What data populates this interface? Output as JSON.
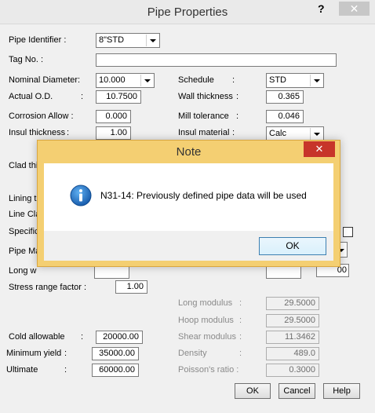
{
  "window": {
    "title": "Pipe Properties",
    "help_glyph": "?",
    "close_glyph": "✕"
  },
  "form": {
    "pipe_identifier": {
      "label": "Pipe Identifier :",
      "value": "8\"STD"
    },
    "tag_no": {
      "label": "Tag No. :",
      "value": ""
    },
    "nominal_diameter": {
      "label": "Nominal Diameter:",
      "value": "10.000"
    },
    "schedule": {
      "label": "Schedule",
      "colon": ":",
      "value": "STD"
    },
    "actual_od": {
      "label": "Actual O.D.",
      "colon": ":",
      "value": "10.7500"
    },
    "wall_thickness": {
      "label": "Wall thickness",
      "colon": ":",
      "value": "0.365"
    },
    "corrosion_allow": {
      "label": "Corrosion Allow :",
      "value": "0.000"
    },
    "mill_tolerance": {
      "label": "Mill tolerance",
      "colon": ":",
      "value": "0.046"
    },
    "insul_thickness": {
      "label": "Insul thickness",
      "colon": ":",
      "value": "1.00"
    },
    "insul_material": {
      "label": "Insul material",
      "colon": ":",
      "value": "Calc"
    },
    "clad_thickness_partial": "Clad thi",
    "lining_partial": "Lining th",
    "line_class_partial": "Line Cla",
    "specification_partial": "Specific",
    "pipe_material_partial": "Pipe Ma",
    "long_weld_partial": "Long w",
    "stress_range_factor": {
      "label": "Stress range factor :",
      "value": "1.00"
    },
    "long_modulus": {
      "label": "Long modulus",
      "colon": ":",
      "value": "29.5000"
    },
    "hoop_modulus": {
      "label": "Hoop modulus",
      "colon": ":",
      "value": "29.5000"
    },
    "shear_modulus": {
      "label": "Shear modulus",
      "colon": ":",
      "value": "11.3462"
    },
    "density": {
      "label": "Density",
      "colon": ":",
      "value": "489.0"
    },
    "poissons_ratio": {
      "label": "Poisson's ratio :",
      "value": "0.3000"
    },
    "cold_allowable": {
      "label": "Cold allowable",
      "colon": ":",
      "value": "20000.00"
    },
    "minimum_yield": {
      "label": "Minimum yield",
      "colon": ":",
      "value": "35000.00"
    },
    "ultimate": {
      "label": "Ultimate",
      "colon": ":",
      "value": "60000.00"
    },
    "partial_value": "00"
  },
  "buttons": {
    "ok": "OK",
    "cancel": "Cancel",
    "help": "Help"
  },
  "note_dialog": {
    "title": "Note",
    "close_glyph": "✕",
    "message": "N31-14:  Previously defined pipe data will be used",
    "ok": "OK"
  },
  "colors": {
    "modal_frame": "#f4cf72",
    "close_red": "#c7352a",
    "info_blue": "#1e72c8"
  }
}
